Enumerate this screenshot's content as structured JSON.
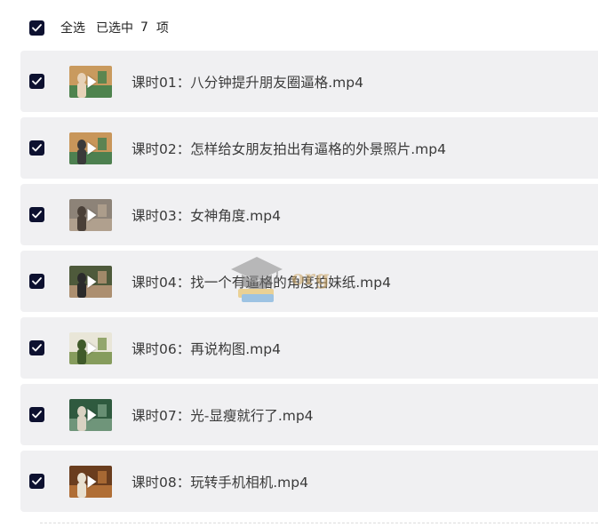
{
  "header": {
    "select_all_label": "全选",
    "selected_text": "已选中",
    "selected_count": "7",
    "unit": "项",
    "checked": true
  },
  "items": [
    {
      "title": "课时01：八分钟提升朋友圈逼格.mp4",
      "checked": true,
      "thumb": {
        "bg": "#c99a5e",
        "accent": "#2f7d4a",
        "figure": "#e7d2b8"
      }
    },
    {
      "title": "课时02：怎样给女朋友拍出有逼格的外景照片.mp4",
      "checked": true,
      "thumb": {
        "bg": "#c8965a",
        "accent": "#2e7a4e",
        "figure": "#3a3a3a"
      }
    },
    {
      "title": "课时03：女神角度.mp4",
      "checked": true,
      "thumb": {
        "bg": "#8d8378",
        "accent": "#b9a893",
        "figure": "#4a4038"
      }
    },
    {
      "title": "课时04：找一个有逼格的角度拍妹纸.mp4",
      "checked": true,
      "thumb": {
        "bg": "#4e5a3b",
        "accent": "#c49c7e",
        "figure": "#2b2b2b"
      }
    },
    {
      "title": "课时06：再说构图.mp4",
      "checked": true,
      "thumb": {
        "bg": "#e9e6d8",
        "accent": "#6d8a3f",
        "figure": "#3f5a2a"
      }
    },
    {
      "title": "课时07：光-显瘦就行了.mp4",
      "checked": true,
      "thumb": {
        "bg": "#2f5a3f",
        "accent": "#7fa48a",
        "figure": "#d9d2c2"
      }
    },
    {
      "title": "课时08：玩转手机相机.mp4",
      "checked": true,
      "thumb": {
        "bg": "#6a3d1e",
        "accent": "#c27a3c",
        "figure": "#e8e0d0"
      }
    }
  ],
  "watermark": {
    "text": "org",
    "icon": "graduation-cap-icon",
    "color": "#c9a05a"
  },
  "colors": {
    "checkbox": "#0d1130",
    "row_bg": "#f0f0f2",
    "text": "#3a3a3a"
  }
}
